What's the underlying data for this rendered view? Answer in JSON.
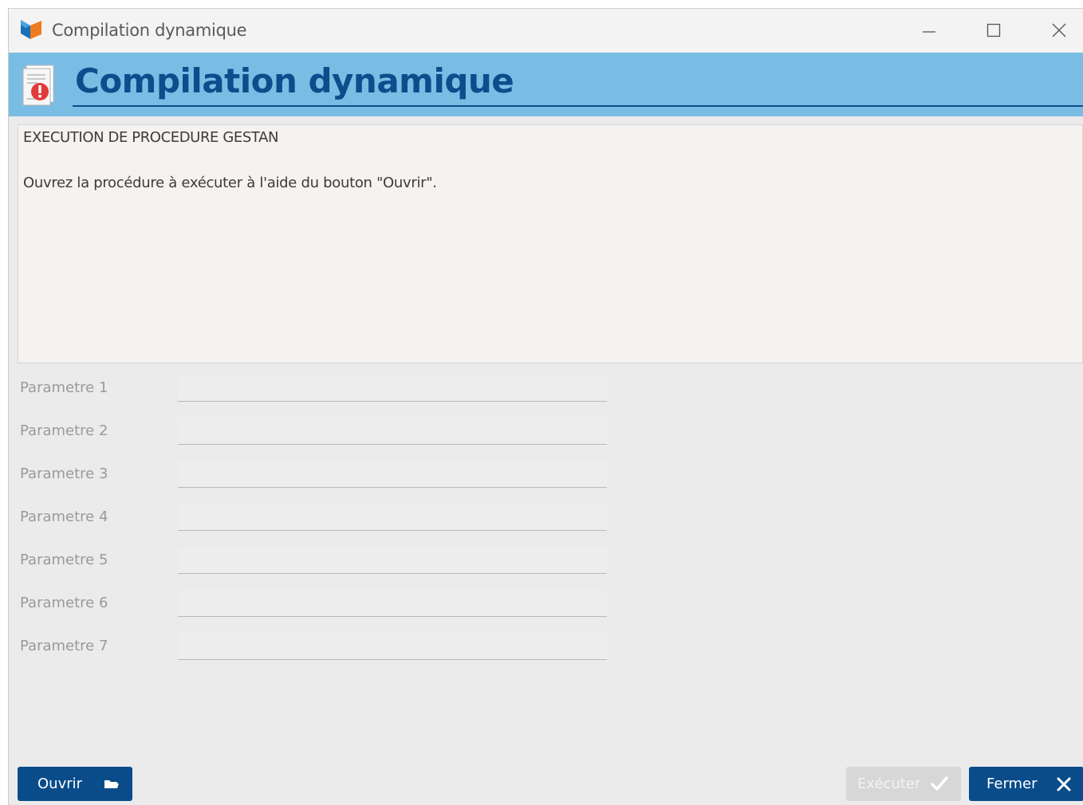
{
  "window": {
    "title": "Compilation dynamique"
  },
  "header": {
    "title": "Compilation dynamique",
    "icon": "document-error-icon"
  },
  "message": {
    "line1": "EXECUTION DE PROCEDURE GESTAN",
    "line2": "Ouvrez la procédure à exécuter à l'aide du bouton \"Ouvrir\"."
  },
  "parameters": [
    {
      "label": "Parametre 1",
      "value": ""
    },
    {
      "label": "Parametre 2",
      "value": ""
    },
    {
      "label": "Parametre 3",
      "value": ""
    },
    {
      "label": "Parametre 4",
      "value": ""
    },
    {
      "label": "Parametre 5",
      "value": ""
    },
    {
      "label": "Parametre 6",
      "value": ""
    },
    {
      "label": "Parametre 7",
      "value": ""
    }
  ],
  "buttons": {
    "open": {
      "label": "Ouvrir",
      "icon": "folder-open-icon"
    },
    "execute": {
      "label": "Exécuter",
      "icon": "checkmark-icon",
      "enabled": false
    },
    "close": {
      "label": "Fermer",
      "icon": "close-x-icon"
    }
  },
  "colors": {
    "header_band": "#7abde4",
    "title_blue": "#0c4d8c",
    "button_primary": "#0a4c8a",
    "button_disabled": "#d7d7d7"
  }
}
